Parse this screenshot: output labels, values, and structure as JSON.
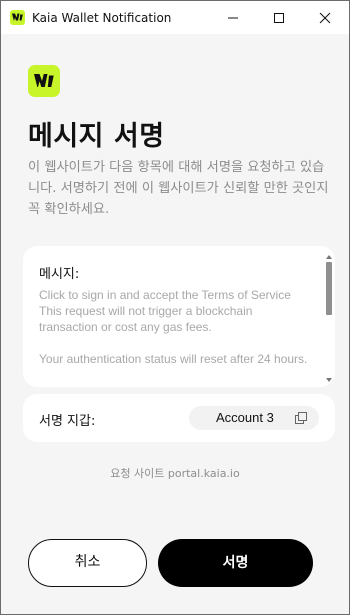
{
  "window": {
    "title": "Kaia Wallet Notification",
    "minimize_icon": "minimize-icon",
    "maximize_icon": "maximize-icon",
    "close_icon": "close-icon"
  },
  "header": {
    "logo_icon": "kaia-wallet-logo-icon",
    "title": "메시지 서명",
    "description": "이 웹사이트가 다음 항목에 대해 서명을 요청하고 있습니다. 서명하기 전에 이 웹사이트가 신뢰할 만한 곳인지 꼭 확인하세요."
  },
  "message": {
    "label": "메시지:",
    "body": "Click to sign in and accept the Terms of Service\nThis request will not trigger a blockchain transaction or cost any gas fees.\n\nYour authentication status will reset after 24 hours."
  },
  "wallet": {
    "label": "서명 지갑:",
    "account": "Account 3",
    "copy_icon": "copy-icon"
  },
  "requester": {
    "text": "요청 사이트 portal.kaia.io"
  },
  "actions": {
    "cancel_label": "취소",
    "sign_label": "서명"
  },
  "colors": {
    "brand_accent": "#c8f42a",
    "primary_button": "#000000",
    "background": "#f5f5f5"
  }
}
